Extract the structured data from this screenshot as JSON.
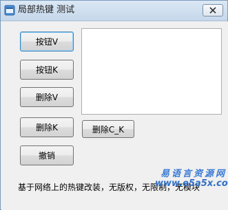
{
  "window": {
    "title": "局部热键 测试",
    "close_icon": "close-icon"
  },
  "buttons": {
    "btn_v": "按钮V",
    "btn_k": "按钮K",
    "delete_v": "删除V",
    "delete_k": "删除K",
    "delete_ck": "删除C_K",
    "cancel": "撤销"
  },
  "listbox": {
    "items": []
  },
  "info_text": "基于网络上的热键改装，无版权，无限制，无模块",
  "watermark": {
    "line1": "易语言资源网",
    "line2": "www.e5a5x.com"
  },
  "colors": {
    "accent": "#3c7fb1",
    "watermark": "#3a7bd5"
  }
}
